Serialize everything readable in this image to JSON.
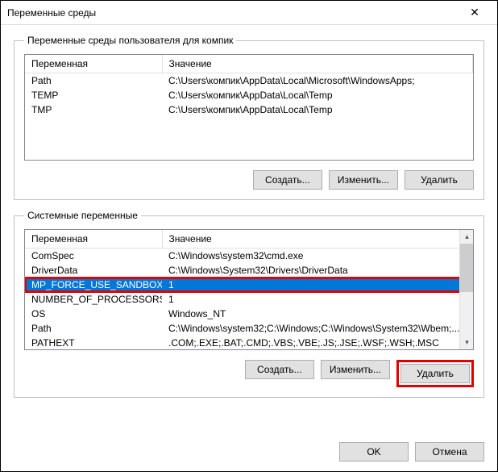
{
  "window": {
    "title": "Переменные среды"
  },
  "user_section": {
    "legend": "Переменные среды пользователя для компик",
    "col_var": "Переменная",
    "col_val": "Значение",
    "rows": [
      {
        "name": "Path",
        "value": "C:\\Users\\компик\\AppData\\Local\\Microsoft\\WindowsApps;"
      },
      {
        "name": "TEMP",
        "value": "C:\\Users\\компик\\AppData\\Local\\Temp"
      },
      {
        "name": "TMP",
        "value": "C:\\Users\\компик\\AppData\\Local\\Temp"
      }
    ],
    "btn_new": "Создать...",
    "btn_edit": "Изменить...",
    "btn_del": "Удалить"
  },
  "sys_section": {
    "legend": "Системные переменные",
    "col_var": "Переменная",
    "col_val": "Значение",
    "selected_index": 2,
    "rows": [
      {
        "name": "ComSpec",
        "value": "C:\\Windows\\system32\\cmd.exe"
      },
      {
        "name": "DriverData",
        "value": "C:\\Windows\\System32\\Drivers\\DriverData"
      },
      {
        "name": "MP_FORCE_USE_SANDBOX",
        "value": "1"
      },
      {
        "name": "NUMBER_OF_PROCESSORS",
        "value": "1"
      },
      {
        "name": "OS",
        "value": "Windows_NT"
      },
      {
        "name": "Path",
        "value": "C:\\Windows\\system32;C:\\Windows;C:\\Windows\\System32\\Wbem;..."
      },
      {
        "name": "PATHEXT",
        "value": ".COM;.EXE;.BAT;.CMD;.VBS;.VBE;.JS;.JSE;.WSF;.WSH;.MSC"
      }
    ],
    "btn_new": "Создать...",
    "btn_edit": "Изменить...",
    "btn_del": "Удалить"
  },
  "footer": {
    "ok": "OK",
    "cancel": "Отмена"
  },
  "highlight": {
    "sys_row_index": 2,
    "sys_delete_button": true
  }
}
